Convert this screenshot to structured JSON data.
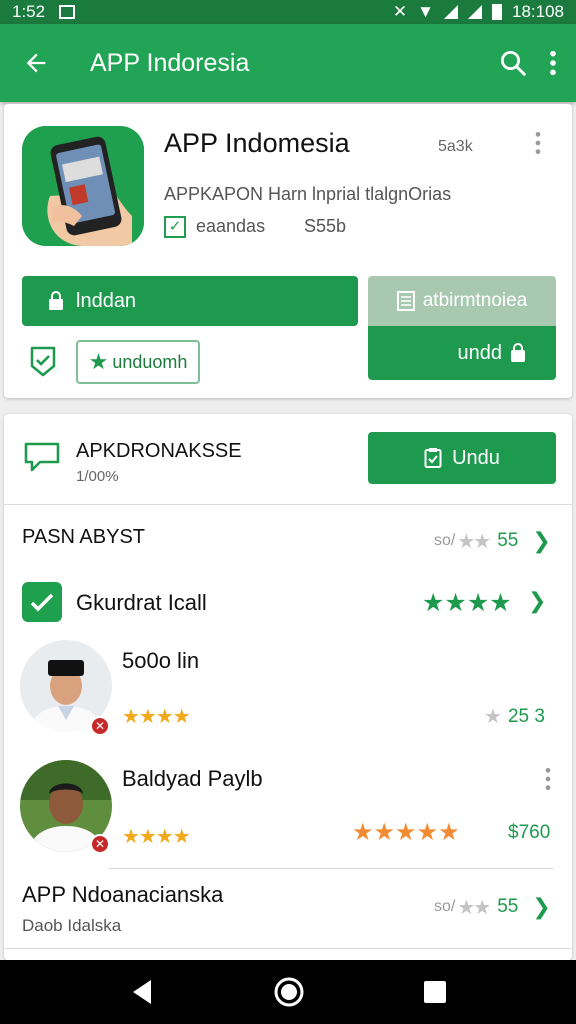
{
  "status_bar": {
    "time_left": "1:52",
    "time_right": "18:108"
  },
  "app_bar": {
    "title": "APP Indoresia"
  },
  "app_card": {
    "name": "APP Indomesia",
    "size": "5a3k",
    "description": "APPKAPON Harn lnprial tlalgnOrias",
    "tag": "eaandas",
    "count": "S55b",
    "install_label": "lnddan",
    "secondary_top_label": "atbirmtnoiea",
    "secondary_bottom_label": "undd",
    "wishlist_label": "unduomh"
  },
  "download_card": {
    "title": "APKDRONAKSSE",
    "subtitle": "1/00%",
    "button_label": "Undu"
  },
  "reviews": {
    "section_title": "PASN ABYST",
    "section_rating": "55",
    "section_rating_prefix": "so/",
    "entry": {
      "name": "Gkurdrat Icall"
    },
    "users": [
      {
        "name": "5o0o lin",
        "rating_value": "25 3",
        "stars": "★★★★",
        "badge": "✕"
      },
      {
        "name": "Baldyad Paylb",
        "price": "$760",
        "stars": "★★★★",
        "orange_stars": "★★★★★",
        "badge": "✕"
      }
    ],
    "item": {
      "title": "APP Ndoanacianska",
      "subtitle": "Daob Idalska",
      "rating": "55",
      "rating_prefix": "so/"
    }
  },
  "colors": {
    "accent": "#1e9a4f",
    "app_bar": "#21a455",
    "status_bar": "#1b7a3e",
    "star_orange": "#f28c34",
    "star_gold": "#f1a91b"
  }
}
